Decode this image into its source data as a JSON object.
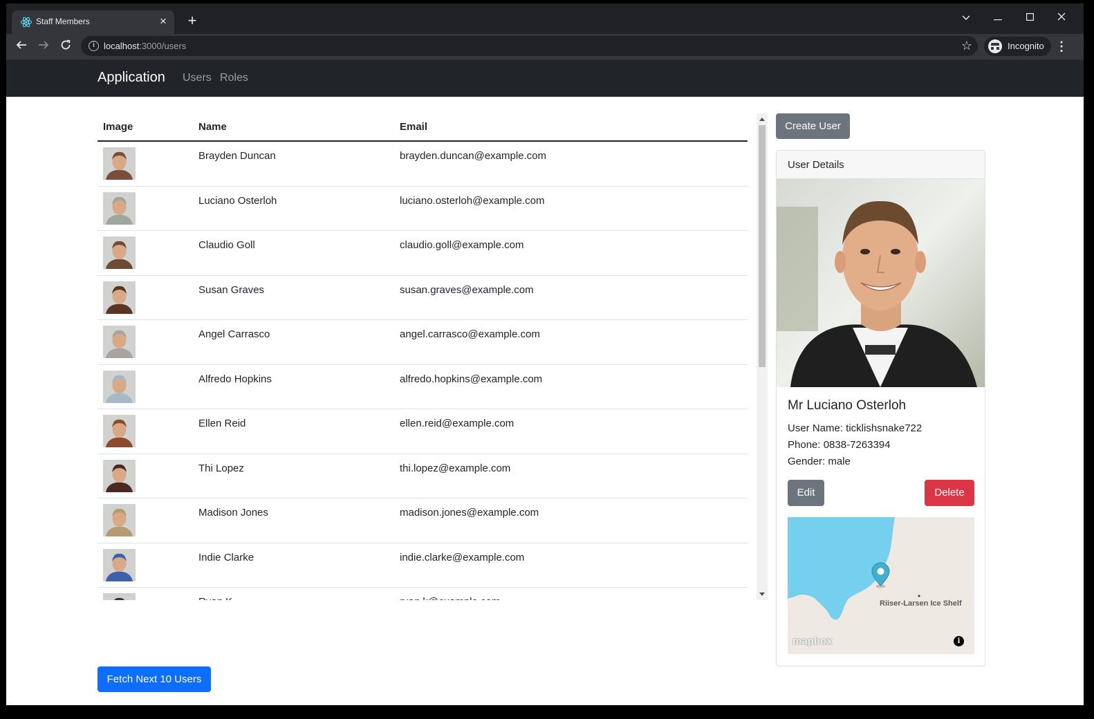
{
  "browser": {
    "tab_title": "Staff Members",
    "url_host": "localhost",
    "url_rest": ":3000/users",
    "profile_label": "Incognito"
  },
  "navbar": {
    "brand": "Application",
    "links": [
      "Users",
      "Roles"
    ]
  },
  "table": {
    "headers": {
      "image": "Image",
      "name": "Name",
      "email": "Email"
    },
    "rows": [
      {
        "name": "Brayden Duncan",
        "email": "brayden.duncan@example.com",
        "avatar_color": "#7a4e3a"
      },
      {
        "name": "Luciano Osterloh",
        "email": "luciano.osterloh@example.com",
        "avatar_color": "#9fa69c"
      },
      {
        "name": "Claudio Goll",
        "email": "claudio.goll@example.com",
        "avatar_color": "#6f4a35"
      },
      {
        "name": "Susan Graves",
        "email": "susan.graves@example.com",
        "avatar_color": "#5a3522"
      },
      {
        "name": "Angel Carrasco",
        "email": "angel.carrasco@example.com",
        "avatar_color": "#a9a49d"
      },
      {
        "name": "Alfredo Hopkins",
        "email": "alfredo.hopkins@example.com",
        "avatar_color": "#a7b9c4"
      },
      {
        "name": "Ellen Reid",
        "email": "ellen.reid@example.com",
        "avatar_color": "#8c4b2c"
      },
      {
        "name": "Thi Lopez",
        "email": "thi.lopez@example.com",
        "avatar_color": "#4a2a20"
      },
      {
        "name": "Madison Jones",
        "email": "madison.jones@example.com",
        "avatar_color": "#b59c6e"
      },
      {
        "name": "Indie Clarke",
        "email": "indie.clarke@example.com",
        "avatar_color": "#3f5faa"
      },
      {
        "name": "Ryan K",
        "email": "ryan.k@example.com",
        "avatar_color": "#333333"
      }
    ]
  },
  "actions": {
    "fetch_next": "Fetch Next 10 Users",
    "create_user": "Create User",
    "edit": "Edit",
    "delete": "Delete"
  },
  "details": {
    "header": "User Details",
    "full_name": "Mr Luciano Osterloh",
    "username_line": "User Name: ticklishsnake722",
    "phone_line": "Phone: 0838-7263394",
    "gender_line": "Gender: male",
    "map_label": "Riiser-Larsen Ice Shelf",
    "map_logo": "mapbox"
  },
  "colors": {
    "primary": "#0d6efd",
    "secondary": "#6c757d",
    "danger": "#dc3545",
    "navbar": "#212529",
    "water": "#75cfee",
    "marker": "#3fb1ce"
  }
}
